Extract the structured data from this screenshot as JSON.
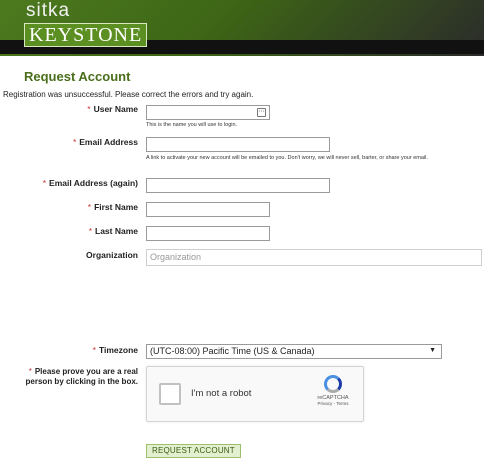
{
  "brand": {
    "top": "sitka",
    "name": "KEYSTONE"
  },
  "page": {
    "title": "Request Account",
    "error_message": "Registration was unsuccessful. Please correct the errors and try again."
  },
  "form": {
    "username": {
      "label": "User Name",
      "required_mark": "*",
      "value": "",
      "help": "This is the name you will use to login."
    },
    "email": {
      "label": "Email Address",
      "required_mark": "*",
      "value": "",
      "help": "A link to activate your new account will be emailed to you. Don't worry, we will never sell, barter, or share your email."
    },
    "email_again": {
      "label": "Email Address (again)",
      "required_mark": "*",
      "value": ""
    },
    "first_name": {
      "label": "First Name",
      "required_mark": "*",
      "value": ""
    },
    "last_name": {
      "label": "Last Name",
      "required_mark": "*",
      "value": ""
    },
    "organization": {
      "label": "Organization",
      "placeholder": "Organization"
    },
    "timezone": {
      "label": "Timezone",
      "required_mark": "*",
      "selected": "(UTC-08:00) Pacific Time (US & Canada)"
    },
    "captcha": {
      "required_mark": "*",
      "label": "Please prove you are a real person by clicking in the box.",
      "checkbox_text": "I'm not a robot",
      "brand": "reCAPTCHA",
      "links": "Privacy - Terms"
    },
    "submit_label": "REQUEST ACCOUNT"
  },
  "icons": {
    "password_manager": "password-manager-icon",
    "dropdown": "dropdown-arrow-icon",
    "recaptcha": "recaptcha-logo-icon"
  }
}
